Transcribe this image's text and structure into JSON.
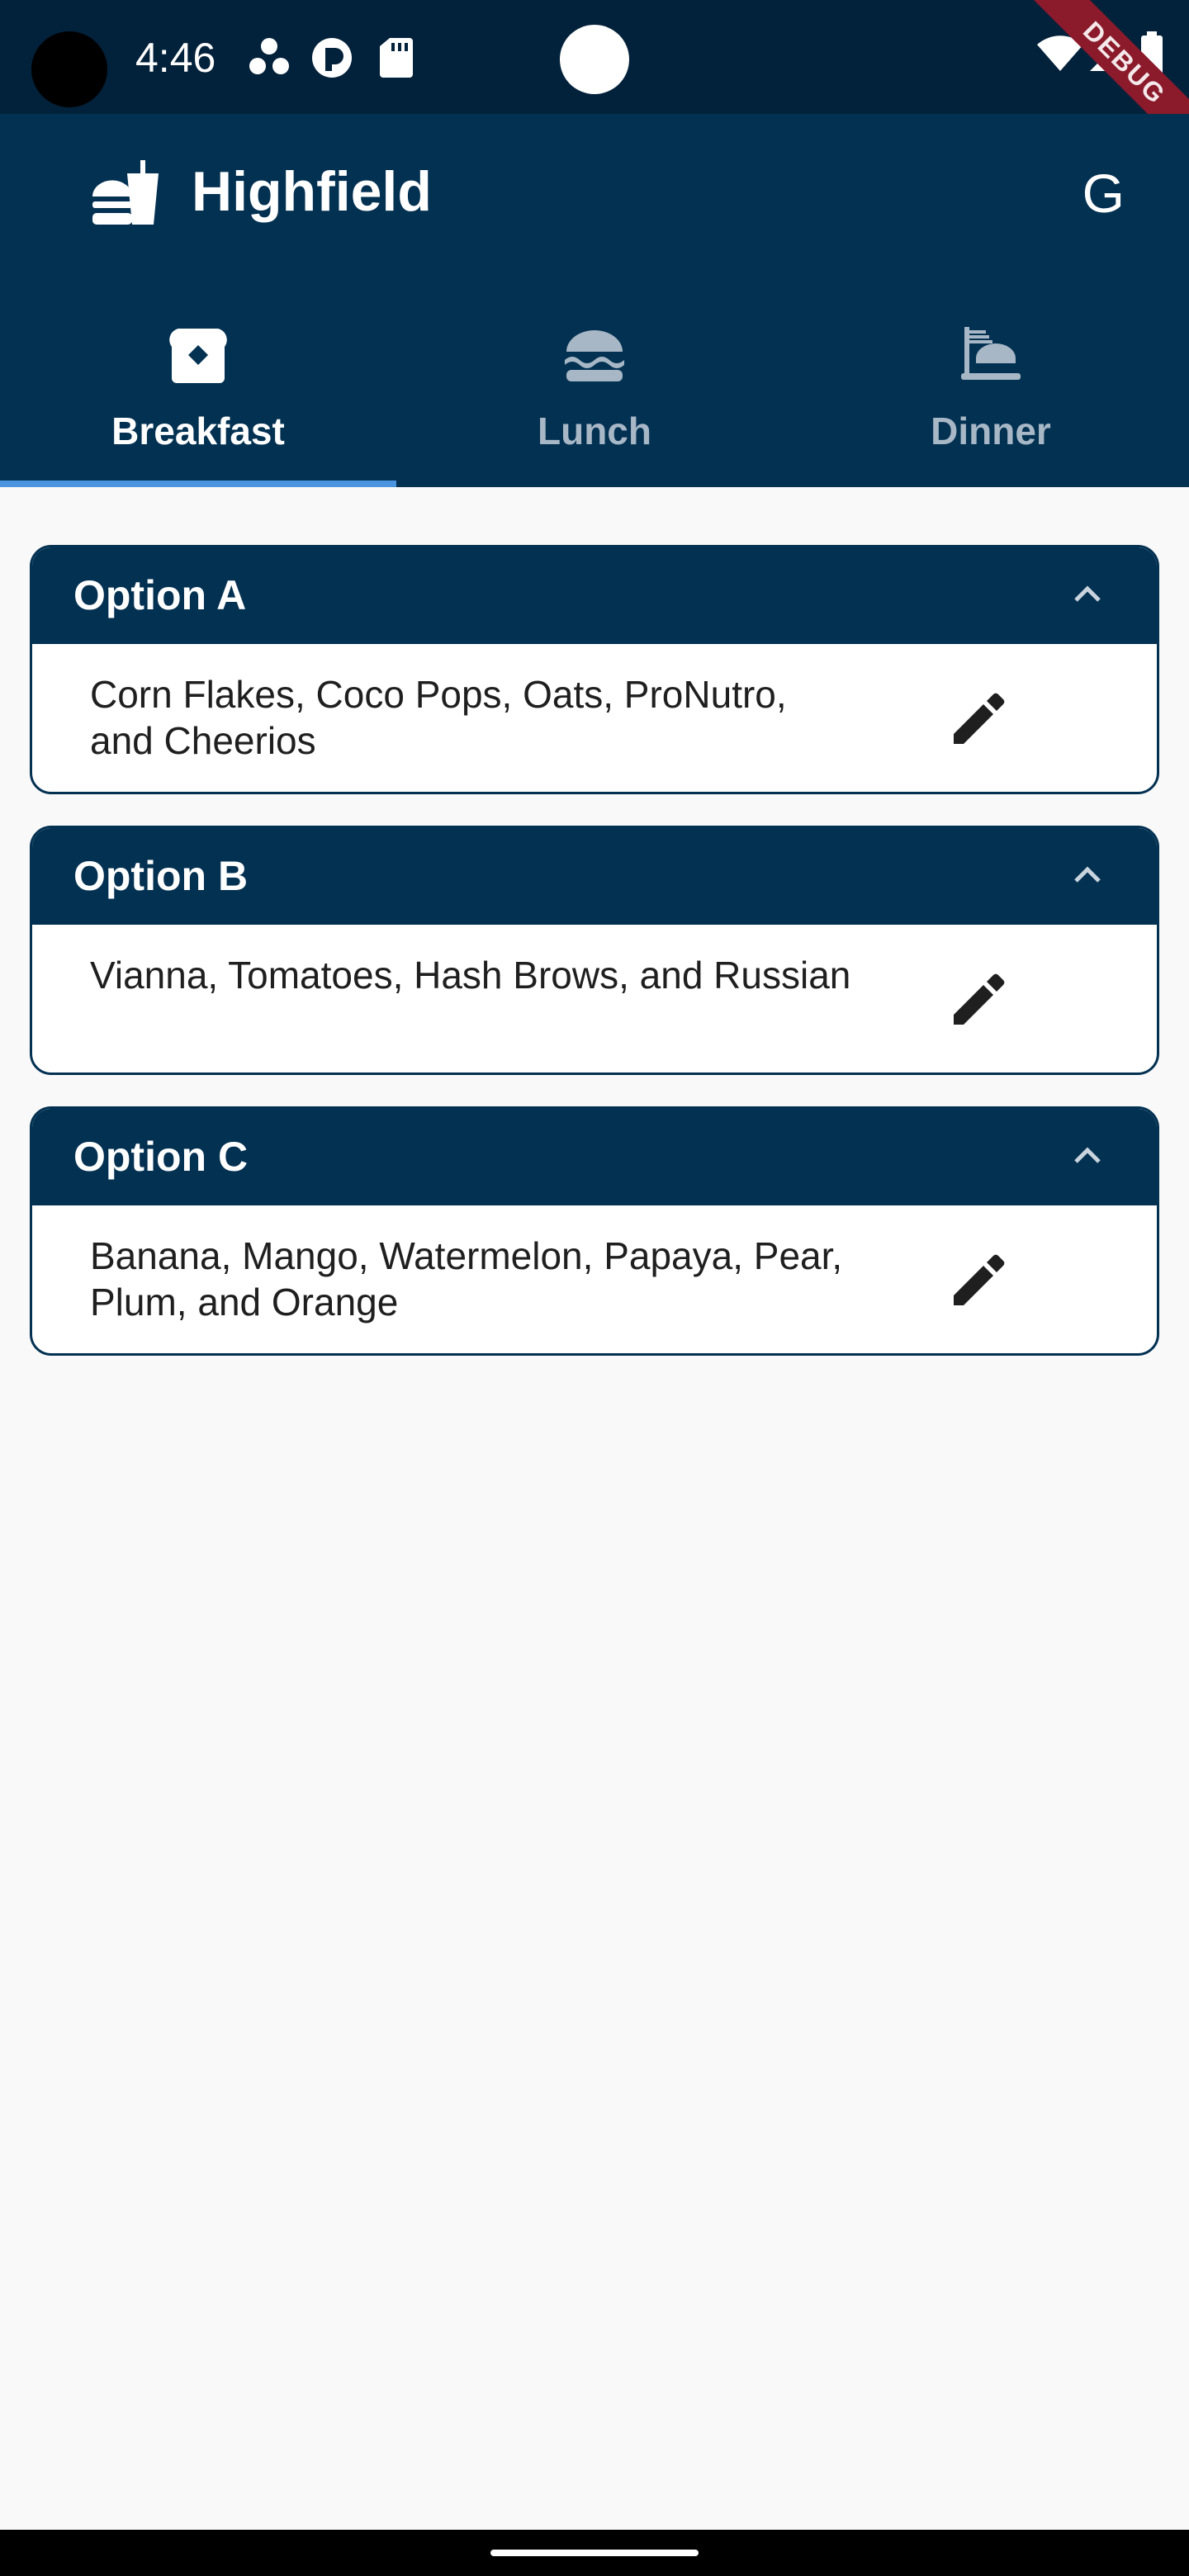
{
  "status_bar": {
    "time": "4:46",
    "debug_label": "DEBUG",
    "icons": [
      "three-dots-icon",
      "app-indicator-icon",
      "sd-card-icon",
      "wifi-icon",
      "signal-icon",
      "battery-icon"
    ]
  },
  "app_bar": {
    "title": "Highfield",
    "logo_icon": "food-drink-icon",
    "action_label": "G",
    "background_color": "#033152"
  },
  "tabs": [
    {
      "label": "Breakfast",
      "icon": "bread-icon",
      "active": true
    },
    {
      "label": "Lunch",
      "icon": "burger-icon",
      "active": false
    },
    {
      "label": "Dinner",
      "icon": "dinner-icon",
      "active": false
    }
  ],
  "options": [
    {
      "title": "Option A",
      "items": "Corn Flakes, Coco Pops, Oats, ProNutro, and Cheerios"
    },
    {
      "title": "Option B",
      "items": "Vianna, Tomatoes, Hash Brows,  and Russian"
    },
    {
      "title": "Option C",
      "items": "Banana, Mango, Watermelon, Papaya, Pear, Plum,  and Orange"
    }
  ],
  "colors": {
    "primary": "#033152",
    "status_bar": "#02213a",
    "tab_indicator": "#4a94e0",
    "inactive_tab": "#a7b7c6",
    "background": "#f9f9f9"
  }
}
